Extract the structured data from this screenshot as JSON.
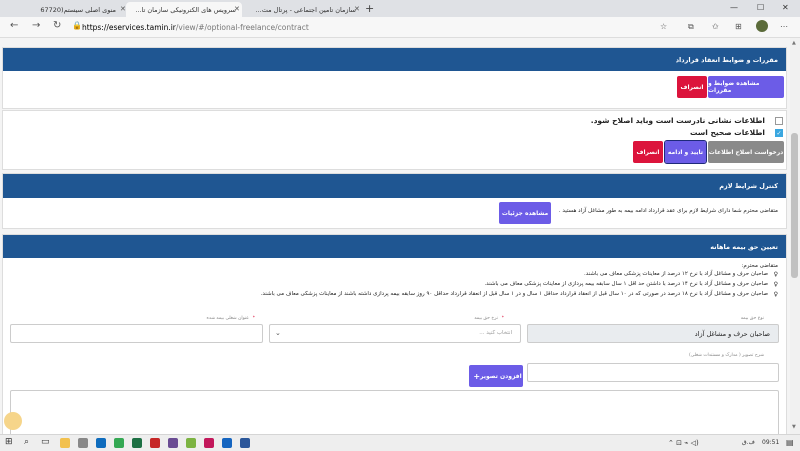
{
  "browser": {
    "tabs": [
      {
        "title": "منوی اصلی سیستم(67720"
      },
      {
        "title": "سرویس های الکترونیکی سازمان تا..."
      },
      {
        "title": "سازمان تامین اجتماعی - پرتال مت..."
      }
    ],
    "url_host": "https://eservices.tamin.ir",
    "url_path": "/view/#/optional-freelance/contract"
  },
  "section1": {
    "title": "مقررات و ضوابط انعقاد قرارداد",
    "view_button": "مشاهده ضوابط و مقررات",
    "cancel_button": "انصراف"
  },
  "section2": {
    "wrong_info": "اطلاعات نشانی نادرست است وباید اصلاح شود.",
    "correct_info": "اطلاعات صحیح است",
    "request_fix_button": "درخواست اصلاح اطلاعات",
    "confirm_button": "تایید و ادامه",
    "cancel_button": "انصراف"
  },
  "section3": {
    "title": "کنترل شرایط لازم",
    "message": "متقاضی محترم شما دارای شرایط لازم برای عقد قرارداد ادامه بیمه به طور مشاغل آزاد هستید .",
    "details_button": "مشاهده جزئیات"
  },
  "section4": {
    "title": "تعیین حق بیمه ماهانه",
    "intro": "متقاضی محترم:",
    "bullets": [
      "صاحبان حرف و مشاغل آزاد با نرخ ۱۲ درصد از معاینات پزشکی معاف می باشند.",
      "صاحبان حرف و مشاغل آزاد با نرخ ۱۴ درصد با داشتن حد اقل ۱ سال سابقه بیمه پردازی از معاینات پزشکی معاف می باشند.",
      "صاحبان حرف و مشاغل آزاد با نرخ ۱۸ درصد در صورتی که در ۱۰ سال قبل از انعقاد قرارداد حداقل ۱ سال و در ۱ سال قبل از انعقاد قرارداد حداقل ۹۰ روز سابقه بیمه پردازی داشته باشند از معاینات پزشکی معاف می باشند."
    ],
    "insurance_type_label": "نوع حق بیمه",
    "insurance_type_value": "صاحبان حرف و مشاغل آزاد",
    "rate_label": "نرخ حق بیمه",
    "rate_placeholder": "انتخاب کنید ...",
    "job_title_label": "عنوان شغلی بیمه شده",
    "image_desc_label": "شرح تصویر ( مدارک و مستندات شغلی)",
    "add_image_button": "افزودن تصویر"
  },
  "taskbar": {
    "language": "ف.ق",
    "time": "09:51"
  }
}
